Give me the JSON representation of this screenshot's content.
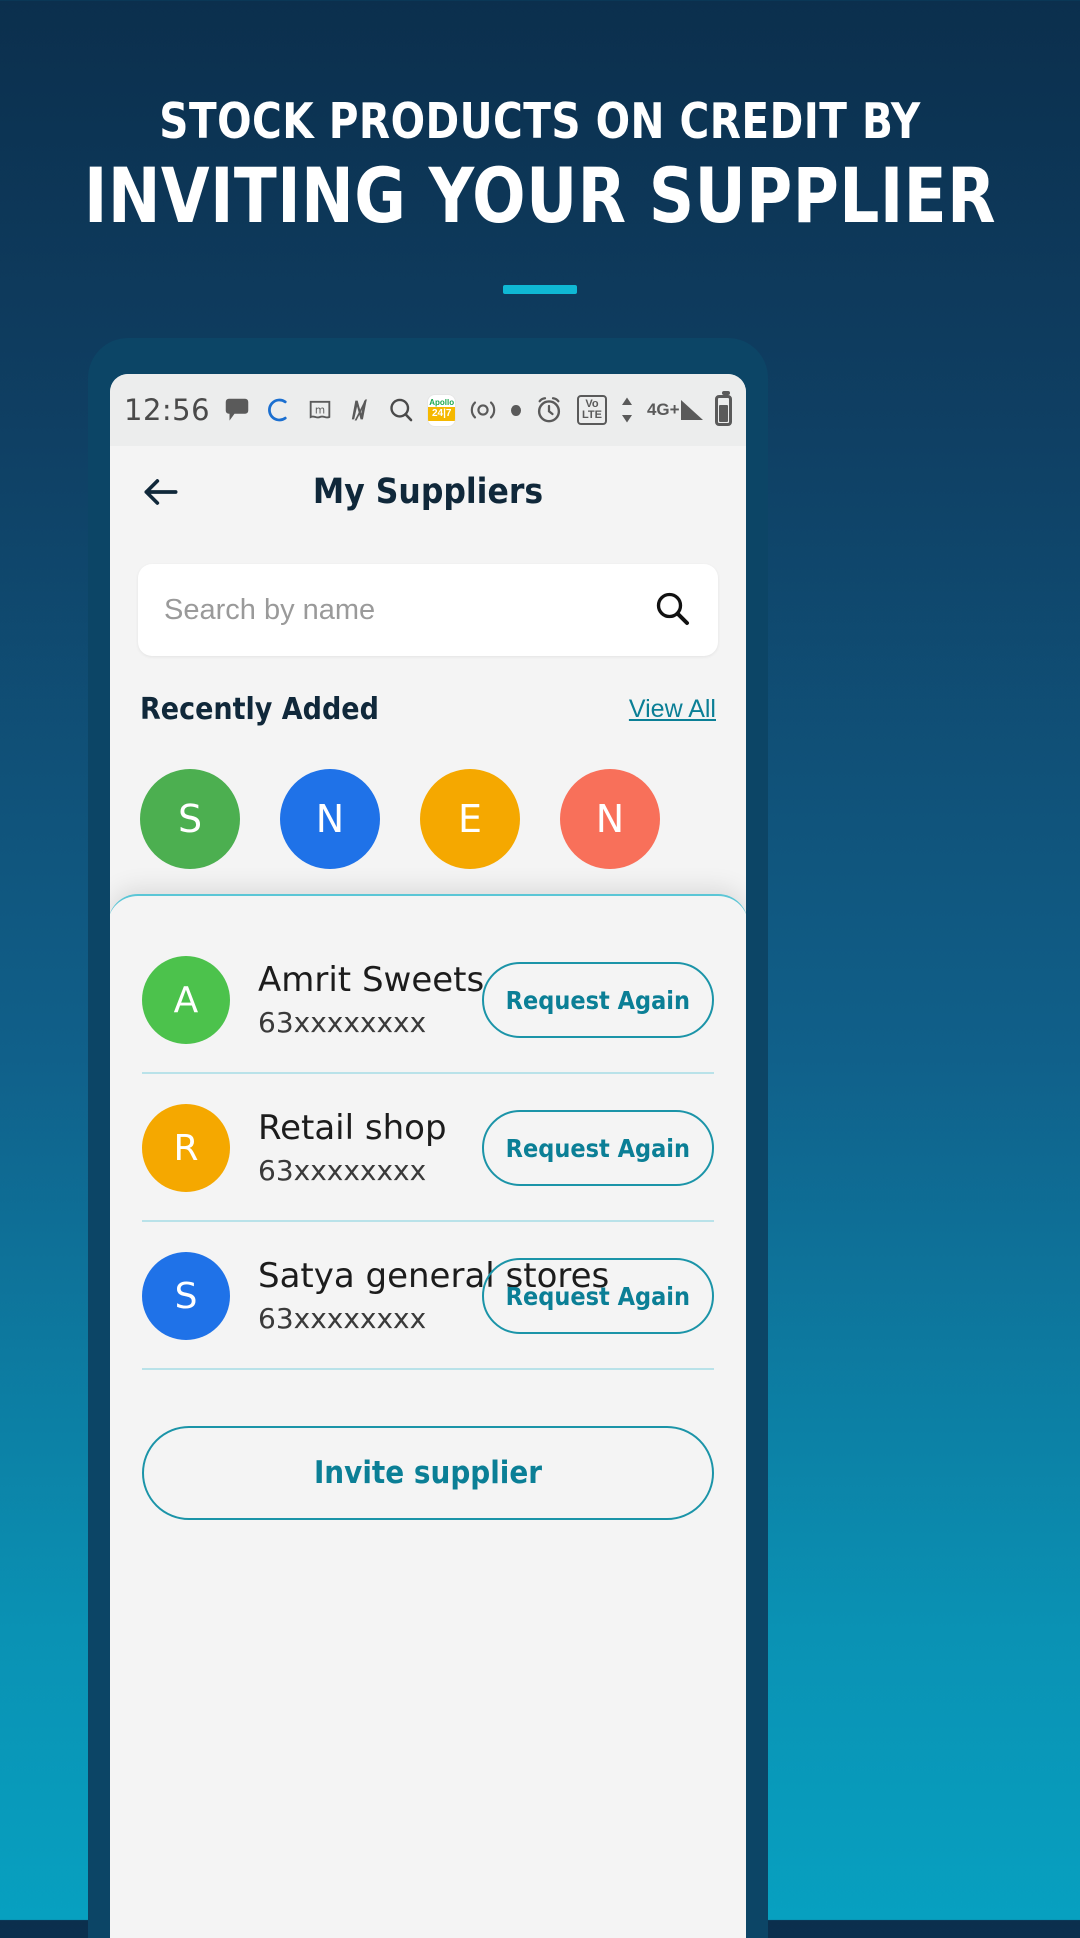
{
  "promo": {
    "line1": "STOCK PRODUCTS ON CREDIT BY",
    "line2": "INVITING YOUR SUPPLIER",
    "accent_color": "#0fb8d4"
  },
  "statusbar": {
    "time": "12:56",
    "icons": [
      "chat-bubble-icon",
      "letter-c-icon",
      "m-flag-icon",
      "n-slash-icon",
      "search-glass-icon",
      "apollo-247-icon",
      "recording-icon",
      "dot-icon",
      "alarm-clock-icon",
      "volte-icon",
      "data-arrows-icon",
      "signal-4g-plus-icon",
      "battery-icon"
    ],
    "apollo_top": "Apollo",
    "apollo_bottom": "24|7",
    "volte_top": "Vo",
    "volte_bottom": "LTE",
    "network": "4G+"
  },
  "appbar": {
    "back_icon": "back-arrow-icon",
    "title": "My Suppliers"
  },
  "search": {
    "placeholder": "Search by name",
    "icon": "search-icon"
  },
  "recently_added": {
    "title": "Recently Added",
    "view_all": "View All",
    "avatars": [
      {
        "letter": "S",
        "color": "#4caf50"
      },
      {
        "letter": "N",
        "color": "#1f72e8"
      },
      {
        "letter": "E",
        "color": "#f5a800"
      },
      {
        "letter": "N",
        "color": "#f8705a"
      }
    ]
  },
  "supplier_card": {
    "suppliers": [
      {
        "letter": "A",
        "color": "#4cc24c",
        "name": "Amrit Sweets",
        "phone": "63xxxxxxxx",
        "action": "Request Again"
      },
      {
        "letter": "R",
        "color": "#f5a800",
        "name": "Retail shop",
        "phone": "63xxxxxxxx",
        "action": "Request Again"
      },
      {
        "letter": "S",
        "color": "#1f72e8",
        "name": "Satya general stores",
        "phone": "63xxxxxxxx",
        "action": "Request Again"
      }
    ],
    "invite_label": "Invite supplier",
    "accent_color": "#0b7f96"
  }
}
